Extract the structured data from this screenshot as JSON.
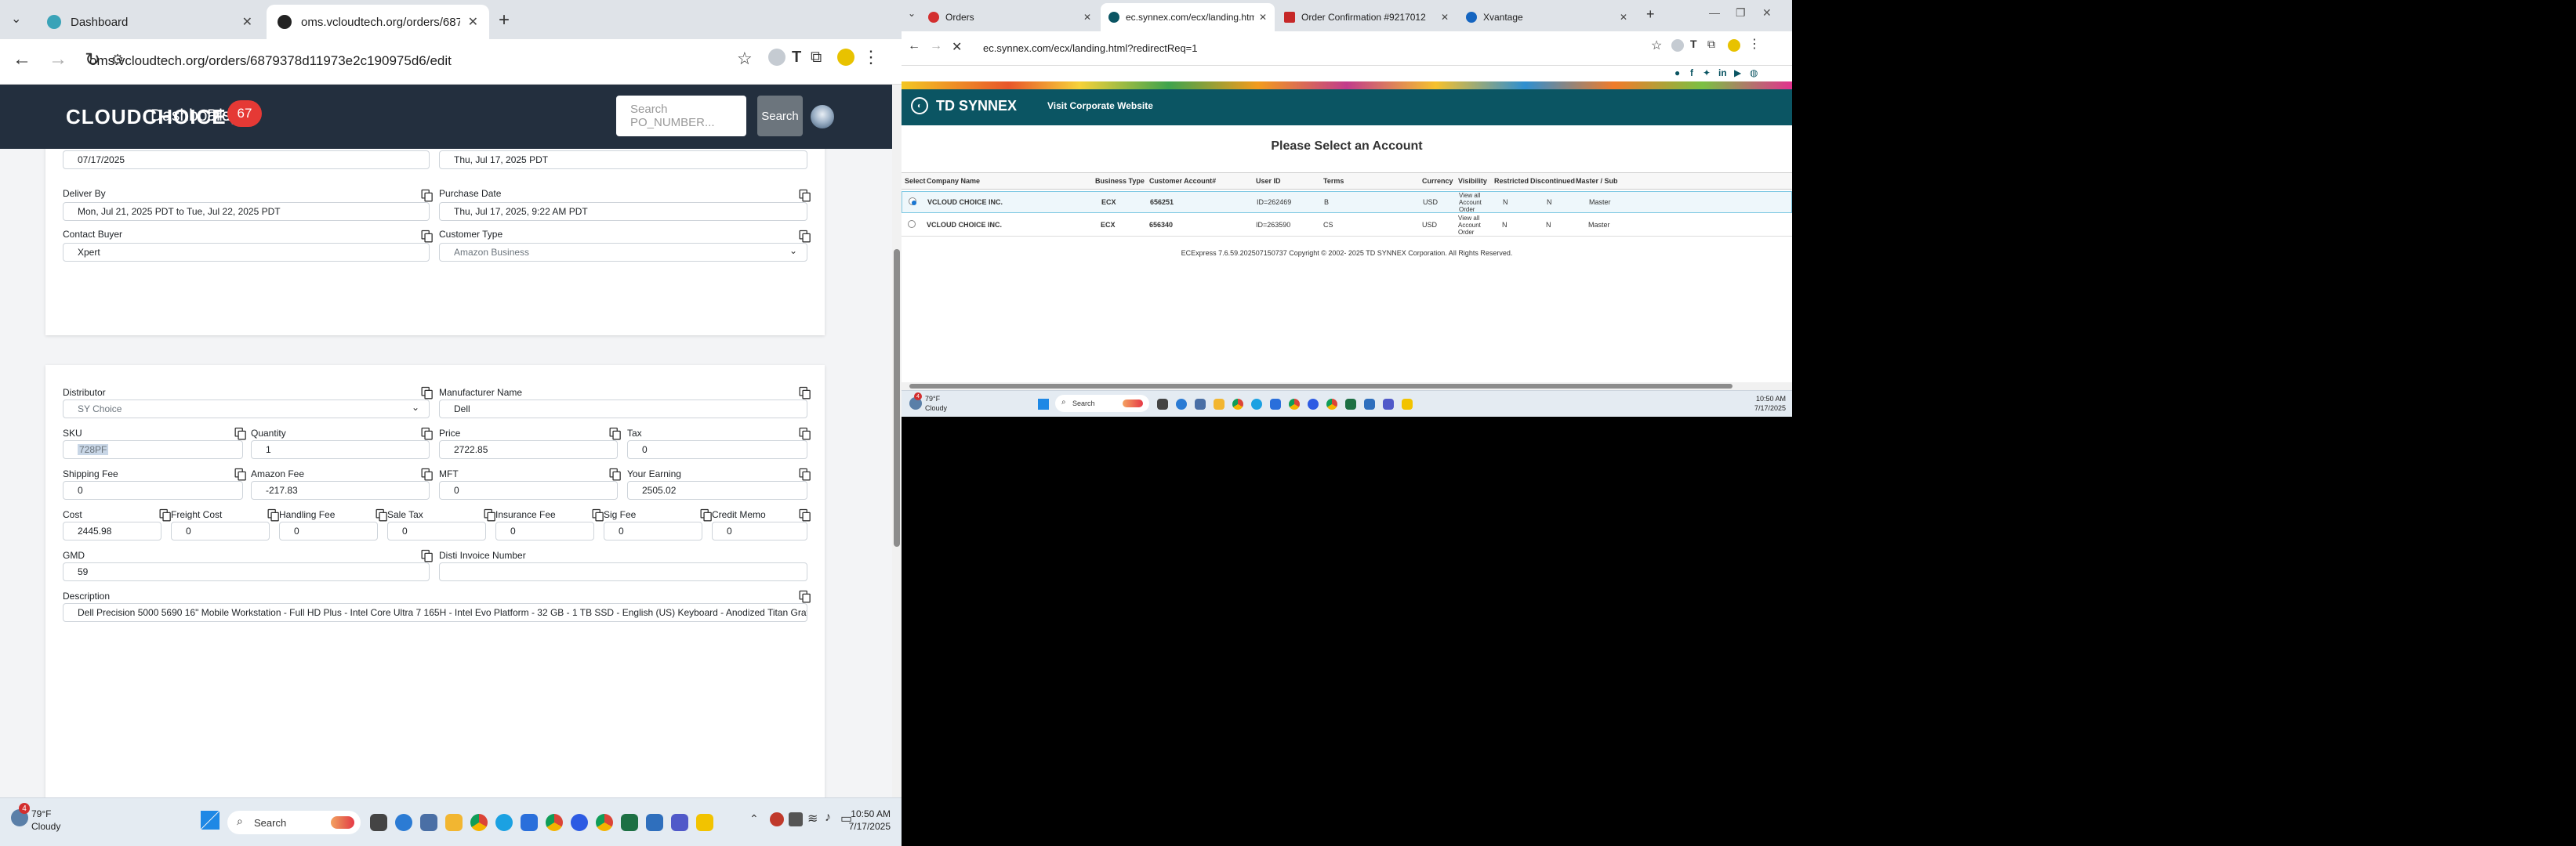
{
  "left": {
    "tabs": [
      {
        "title": "Dashboard",
        "active": false
      },
      {
        "title": "oms.vcloudtech.org/orders/687",
        "active": true
      }
    ],
    "url": "oms.vcloudtech.org/orders/6879378d11973e2c190975d6/edit",
    "nav": {
      "logo": "CLOUDCHOICE",
      "dashboard": "Dashboard",
      "disputes": "Dispu",
      "disputes_badge": "67",
      "search_placeholder": "Search PO_NUMBER...",
      "search_button": "Search"
    },
    "card1": {
      "row0": {
        "left_value": "07/17/2025",
        "right_value": "Thu, Jul 17, 2025 PDT"
      },
      "deliver_by": {
        "label": "Deliver By",
        "value": "Mon, Jul 21, 2025 PDT to Tue, Jul 22, 2025 PDT"
      },
      "purchase_date": {
        "label": "Purchase Date",
        "value": "Thu, Jul 17, 2025, 9:22 AM PDT"
      },
      "contact_buyer": {
        "label": "Contact Buyer",
        "value": "Xpert"
      },
      "customer_type": {
        "label": "Customer Type",
        "value": "Amazon Business"
      }
    },
    "card2": {
      "distributor": {
        "label": "Distributor",
        "value": "SY Choice"
      },
      "manufacturer": {
        "label": "Manufacturer Name",
        "value": "Dell"
      },
      "sku": {
        "label": "SKU",
        "value": "728PF"
      },
      "quantity": {
        "label": "Quantity",
        "value": "1"
      },
      "price": {
        "label": "Price",
        "value": "2722.85"
      },
      "tax": {
        "label": "Tax",
        "value": "0"
      },
      "shipping_fee": {
        "label": "Shipping Fee",
        "value": "0"
      },
      "amazon_fee": {
        "label": "Amazon Fee",
        "value": "-217.83"
      },
      "mft": {
        "label": "MFT",
        "value": "0"
      },
      "your_earning": {
        "label": "Your Earning",
        "value": "2505.02"
      },
      "cost": {
        "label": "Cost",
        "value": "2445.98"
      },
      "freight_cost": {
        "label": "Freight Cost",
        "value": "0"
      },
      "handling_fee": {
        "label": "Handling Fee",
        "value": "0"
      },
      "sale_tax": {
        "label": "Sale Tax",
        "value": "0"
      },
      "insurance_fee": {
        "label": "Insurance Fee",
        "value": "0"
      },
      "sig_fee": {
        "label": "Sig Fee",
        "value": "0"
      },
      "credit_memo": {
        "label": "Credit Memo",
        "value": "0"
      },
      "gmd": {
        "label": "GMD",
        "value": "59"
      },
      "disti_invoice": {
        "label": "Disti Invoice Number",
        "value": ""
      },
      "description": {
        "label": "Description",
        "value": "Dell Precision 5000 5690 16\" Mobile Workstation - Full HD Plus - Intel Core Ultra 7 165H - Intel Evo Platform - 32 GB - 1 TB SSD - English (US) Keyboard - Anodized Titan Gray"
      }
    },
    "taskbar": {
      "weather_temp": "79°F",
      "weather_desc": "Cloudy",
      "weather_badge": "4",
      "search": "Search",
      "time": "10:50 AM",
      "date": "7/17/2025"
    }
  },
  "right": {
    "tabs": [
      {
        "title": "Orders",
        "active": false
      },
      {
        "title": "ec.synnex.com/ecx/landing.htm",
        "active": true
      },
      {
        "title": "Order Confirmation #9217012",
        "active": false
      },
      {
        "title": "Xvantage",
        "active": false
      }
    ],
    "url": "ec.synnex.com/ecx/landing.html?redirectReq=1",
    "brand": "TD SYNNEX",
    "visit_link": "Visit Corporate Website",
    "heading": "Please Select an Account",
    "columns": [
      "Select",
      "Company Name",
      "Business Type",
      "Customer Account#",
      "User ID",
      "Terms",
      "Currency",
      "Visibility",
      "Restricted",
      "Discontinued",
      "Master / Sub"
    ],
    "rows": [
      {
        "selected": true,
        "company": "VCLOUD CHOICE INC.",
        "business_type": "ECX",
        "account": "656251",
        "user_id": "ID=262469",
        "terms": "B",
        "currency": "USD",
        "visibility": "View all Account Order",
        "restricted": "N",
        "discontinued": "N",
        "master": "Master"
      },
      {
        "selected": false,
        "company": "VCLOUD CHOICE INC.",
        "business_type": "ECX",
        "account": "656340",
        "user_id": "ID=263590",
        "terms": "CS",
        "currency": "USD",
        "visibility": "View all Account Order",
        "restricted": "N",
        "discontinued": "N",
        "master": "Master"
      }
    ],
    "copyright": "ECExpress 7.6.59.202507150737 Copyright © 2002- 2025 TD SYNNEX Corporation. All Rights Reserved.",
    "taskbar": {
      "weather_temp": "79°F",
      "weather_desc": "Cloudy",
      "weather_badge": "4",
      "search": "Search",
      "time": "10:50 AM",
      "date": "7/17/2025"
    }
  }
}
